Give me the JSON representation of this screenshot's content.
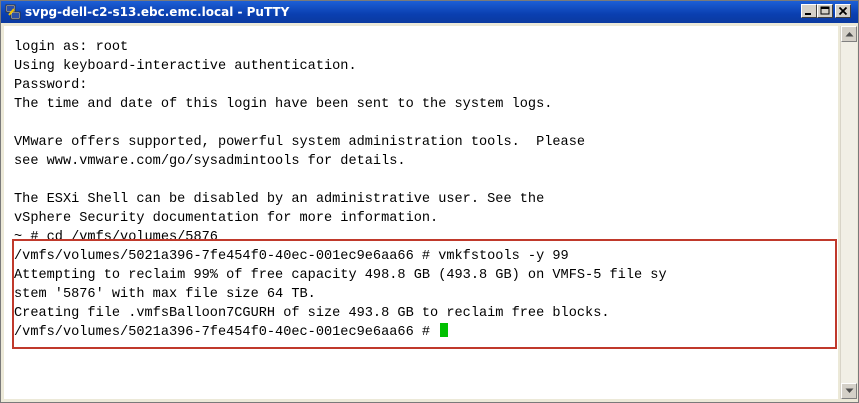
{
  "window": {
    "title": "svpg-dell-c2-s13.ebc.emc.local - PuTTY",
    "icon": "putty-icon",
    "controls": {
      "minimize": "minimize-icon",
      "maximize": "maximize-icon",
      "close": "close-icon"
    }
  },
  "terminal": {
    "lines": [
      "login as: root",
      "Using keyboard-interactive authentication.",
      "Password:",
      "The time and date of this login have been sent to the system logs.",
      "",
      "VMware offers supported, powerful system administration tools.  Please",
      "see www.vmware.com/go/sysadmintools for details.",
      "",
      "The ESXi Shell can be disabled by an administrative user. See the",
      "vSphere Security documentation for more information.",
      "~ # cd /vmfs/volumes/5876",
      "/vmfs/volumes/5021a396-7fe454f0-40ec-001ec9e6aa66 # vmkfstools -y 99",
      "Attempting to reclaim 99% of free capacity 498.8 GB (493.8 GB) on VMFS-5 file sy",
      "stem '5876' with max file size 64 TB.",
      "Creating file .vmfsBalloon7CGURH of size 493.8 GB to reclaim free blocks.",
      "/vmfs/volumes/5021a396-7fe454f0-40ec-001ec9e6aa66 # "
    ],
    "cursor_color": "#00c000",
    "highlight_color": "#c0392b"
  },
  "scrollbar": {
    "up_icon": "scroll-up-arrow-icon",
    "down_icon": "scroll-down-arrow-icon"
  }
}
